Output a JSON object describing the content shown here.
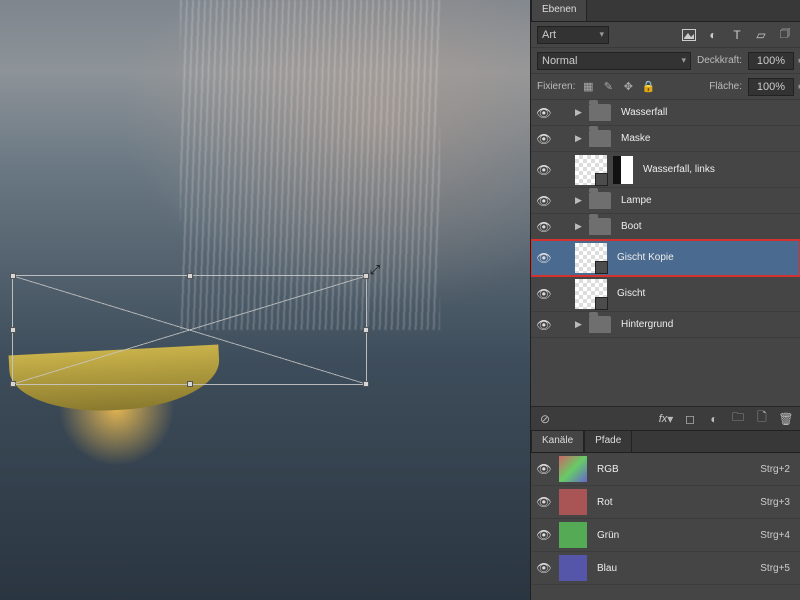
{
  "panel_tab": "Ebenen",
  "filter": {
    "kind_label": "Art"
  },
  "blend": {
    "mode": "Normal",
    "opacity_label": "Deckkraft:",
    "opacity_value": "100%",
    "fill_label": "Fläche:",
    "fill_value": "100%"
  },
  "lock_label": "Fixieren:",
  "layers": [
    {
      "name": "Wasserfall",
      "type": "group"
    },
    {
      "name": "Maske",
      "type": "group"
    },
    {
      "name": "Wasserfall, links",
      "type": "smart-mask"
    },
    {
      "name": "Lampe",
      "type": "group"
    },
    {
      "name": "Boot",
      "type": "group"
    },
    {
      "name": "Gischt Kopie",
      "type": "smart",
      "selected": true
    },
    {
      "name": "Gischt",
      "type": "smart"
    },
    {
      "name": "Hintergrund",
      "type": "group"
    }
  ],
  "channels_tabs": [
    "Kanäle",
    "Pfade"
  ],
  "channels": [
    {
      "name": "RGB",
      "shortcut": "Strg+2",
      "swatch": "rgb"
    },
    {
      "name": "Rot",
      "shortcut": "Strg+3",
      "swatch": "r"
    },
    {
      "name": "Grün",
      "shortcut": "Strg+4",
      "swatch": "g"
    },
    {
      "name": "Blau",
      "shortcut": "Strg+5",
      "swatch": "b"
    }
  ]
}
